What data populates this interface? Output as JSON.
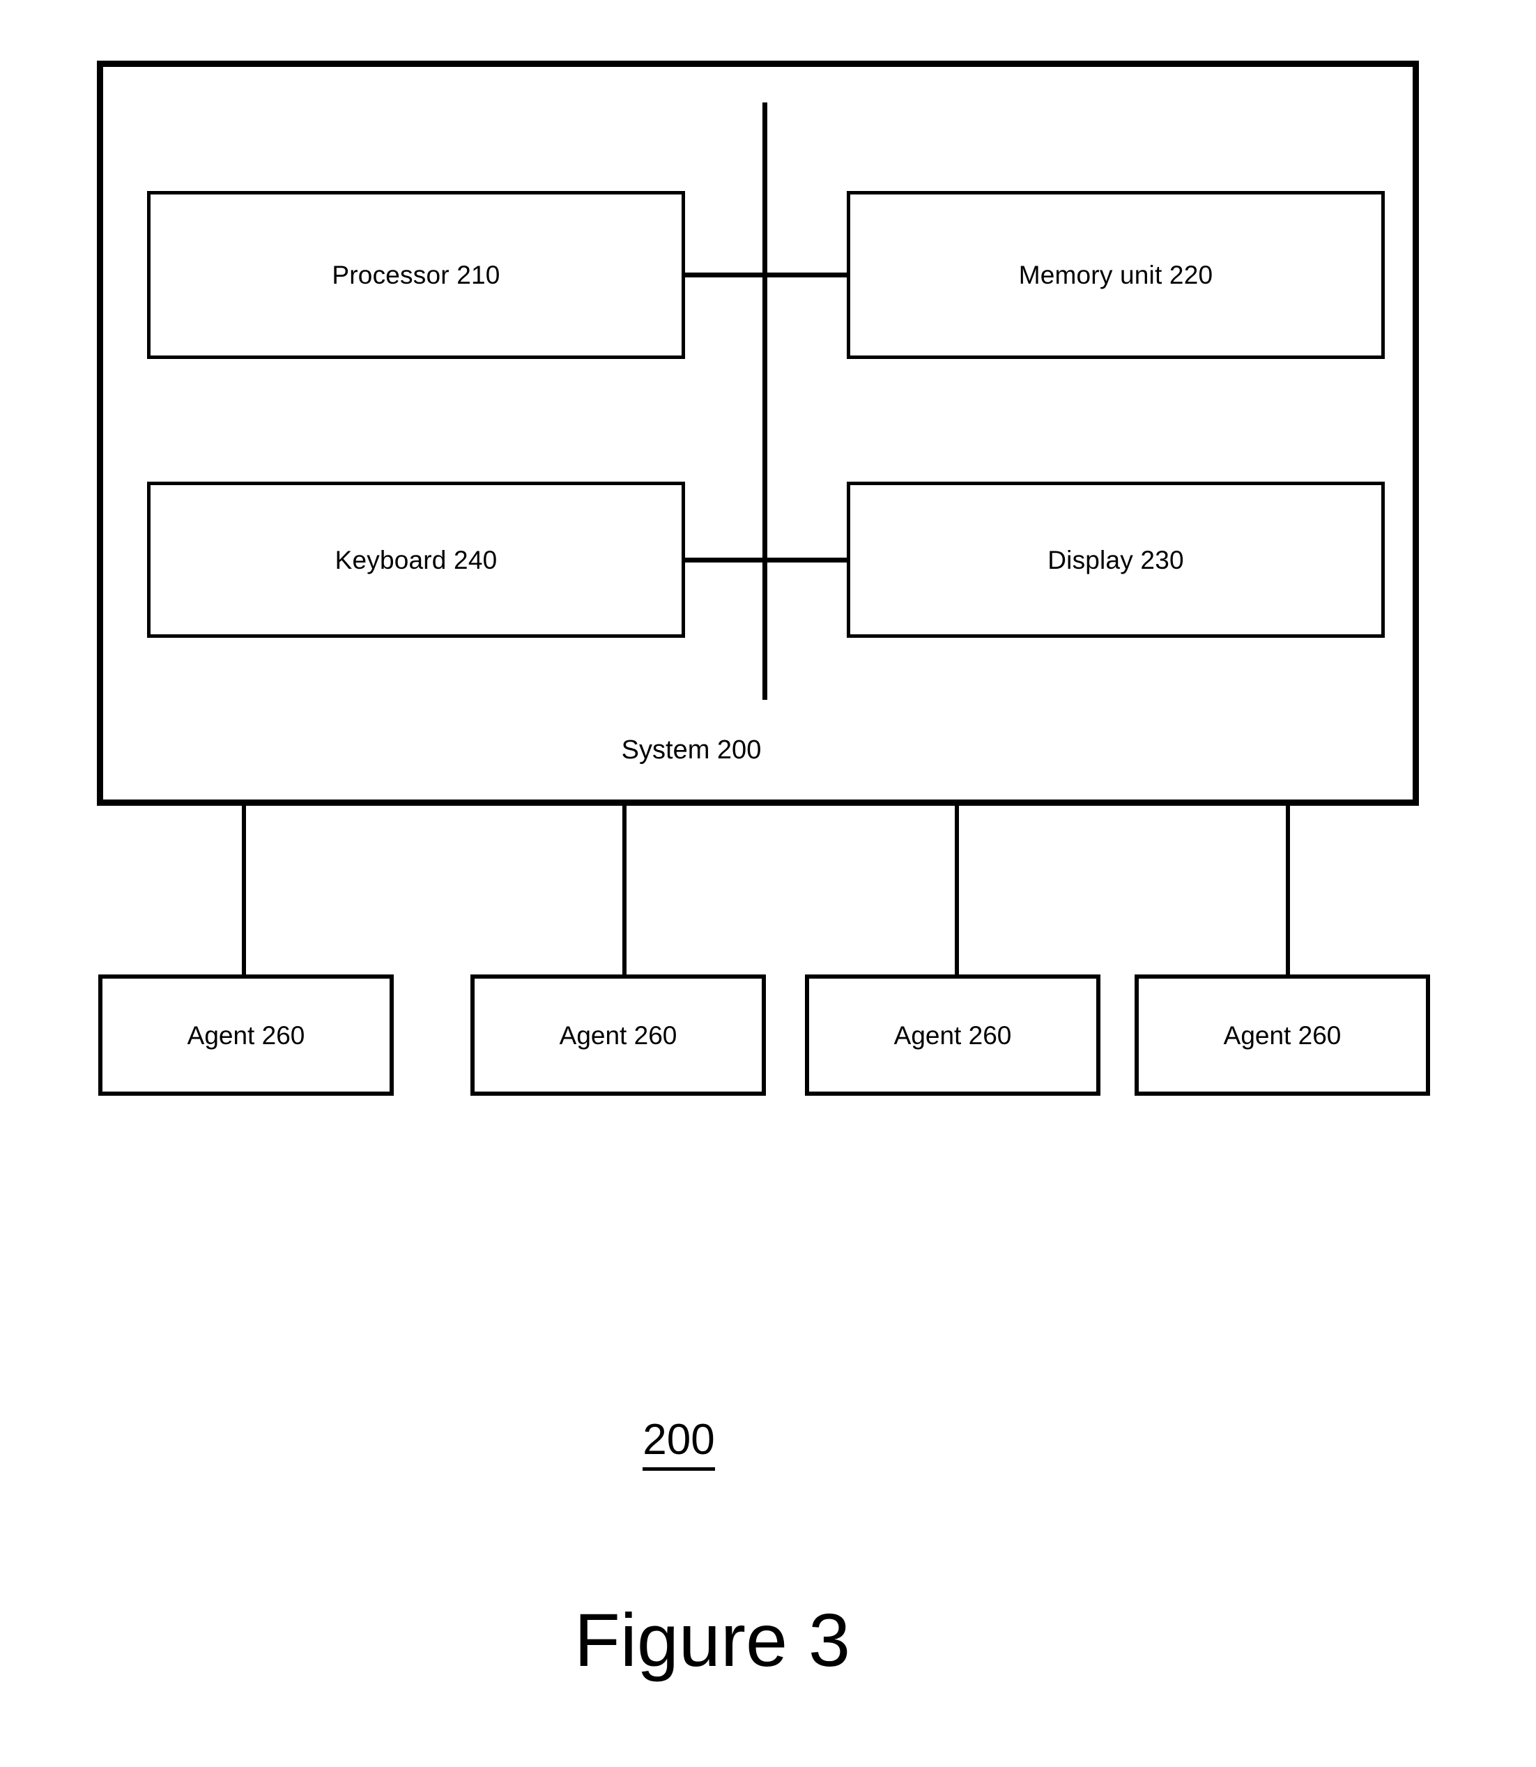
{
  "figure": {
    "caption": "Figure 3",
    "reference_numeral": "200"
  },
  "system": {
    "caption": "System 200",
    "components": [
      {
        "id": "processor",
        "label": "Processor 210"
      },
      {
        "id": "memory",
        "label": "Memory unit 220"
      },
      {
        "id": "keyboard",
        "label": "Keyboard 240"
      },
      {
        "id": "display",
        "label": "Display 230"
      }
    ],
    "bus": {
      "name": "system-bus",
      "orientation": "vertical"
    }
  },
  "agents": [
    {
      "label": "Agent 260"
    },
    {
      "label": "Agent 260"
    },
    {
      "label": "Agent 260"
    },
    {
      "label": "Agent 260"
    }
  ],
  "colors": {
    "stroke": "#000000",
    "background": "#ffffff"
  }
}
